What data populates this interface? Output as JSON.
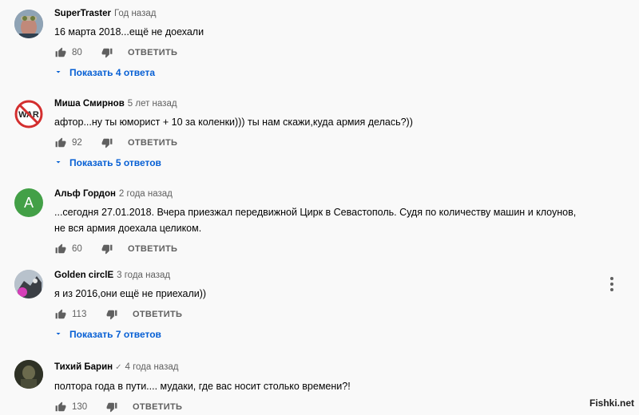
{
  "comments": [
    {
      "author": "SuperTraster",
      "time": "Год назад",
      "text": "16 марта 2018...ещё не доехали",
      "likes": "80",
      "reply": "ОТВЕТИТЬ",
      "replies": "Показать 4 ответа",
      "avatar_icon": "photo-avatar-icon"
    },
    {
      "author": "Миша Смирнов",
      "time": "5 лет назад",
      "text": "афтор...ну ты юморист + 10 за коленки))) ты нам скажи,куда армия делась?))",
      "likes": "92",
      "reply": "ОТВЕТИТЬ",
      "replies": "Показать 5 ответов",
      "avatar_icon": "no-war-sign-avatar-icon",
      "avatar_text": "WAR"
    },
    {
      "author": "Альф Гордон",
      "time": "2 года назад",
      "text_lines": [
        "...сегодня 27.01.2018. Вчера приезжал передвижной Цирк в Севастополь. Судя по количеству машин и клоунов,",
        "не вся армия доехала целиком."
      ],
      "likes": "60",
      "reply": "ОТВЕТИТЬ",
      "avatar_letter": "A",
      "avatar_color": "#43a047"
    },
    {
      "author": "Golden circlE",
      "time": "3 года назад",
      "text": "я из 2016,они ещё не приехали))",
      "likes": "113",
      "reply": "ОТВЕТИТЬ",
      "replies": "Показать 7 ответов",
      "avatar_icon": "photo-avatar-icon"
    },
    {
      "author": "Тихий Барин",
      "time": "4 года назад",
      "text": "полтора года в пути.... мудаки, где вас носит столько времени?!",
      "likes": "130",
      "reply": "ОТВЕТИТЬ",
      "avatar_icon": "photo-avatar-icon"
    }
  ],
  "watermark": "Fishki.net",
  "colors": {
    "background": "#f9f9f9",
    "link": "#065fd4",
    "secondary": "#606060"
  }
}
